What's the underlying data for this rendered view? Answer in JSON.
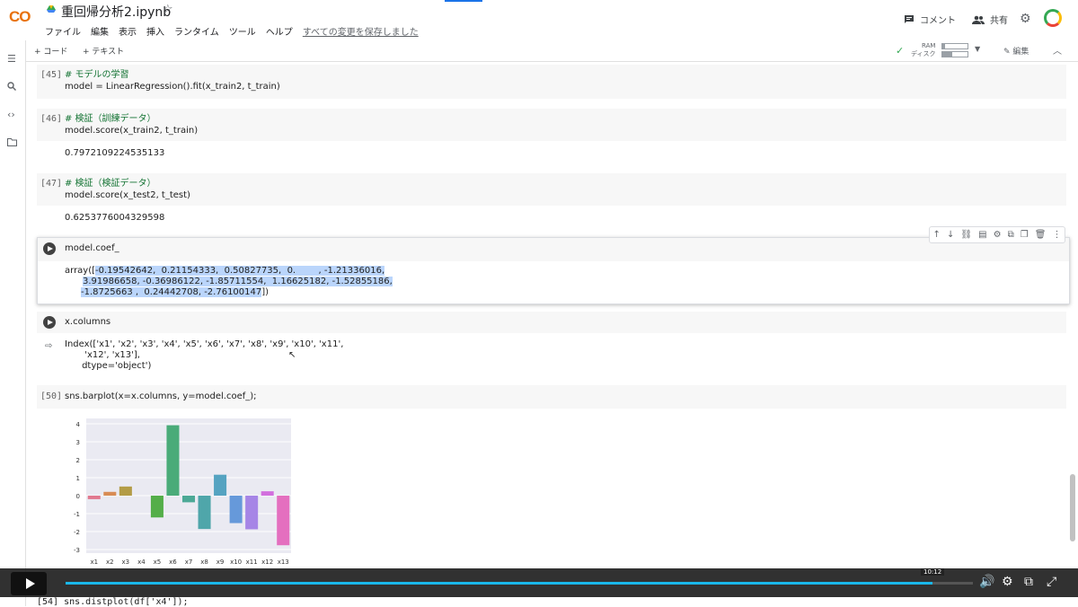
{
  "app": {
    "logo": "CO",
    "notebook_title": "重回帰分析2.ipynb",
    "star": "☆",
    "menu": [
      "ファイル",
      "編集",
      "表示",
      "挿入",
      "ランタイム",
      "ツール",
      "ヘルプ"
    ],
    "saved_message": "すべての変更を保存しました",
    "comment_label": "コメント",
    "share_label": "共有"
  },
  "toolbar": {
    "add_code": "+ コード",
    "add_text": "+ テキスト",
    "ram_label": "RAM",
    "disk_label": "ディスク",
    "ram_level": 0.1,
    "disk_level": 0.4,
    "edit_label": "編集"
  },
  "cells": {
    "c45": {
      "prompt": "[45]",
      "comment": "# モデルの学習",
      "code": "model = LinearRegression().fit(x_train2, t_train)"
    },
    "c46": {
      "prompt": "[46]",
      "comment": "# 検証（訓練データ）",
      "code": "model.score(x_train2, t_train)",
      "output": "0.7972109224535133"
    },
    "c47": {
      "prompt": "[47]",
      "comment": "# 検証（検証データ）",
      "code": "model.score(x_test2, t_test)",
      "output": "0.6253776004329598"
    },
    "coef": {
      "code": "model.coef_",
      "out_prefix": "array([",
      "out_line1": "-0.19542642,  0.21154333,  0.50827735,  0.        , -1.21336016,",
      "out_line2": "3.91986658, -0.36986122, -1.85711554,  1.16625182, -1.52855186,",
      "out_line3": "-1.8725663 ,  0.24442708, -2.76100147",
      "out_suffix": "])"
    },
    "columns": {
      "code": "x.columns",
      "output": "Index(['x1', 'x2', 'x3', 'x4', 'x5', 'x6', 'x7', 'x8', 'x9', 'x10', 'x11',\n       'x12', 'x13'],\n      dtype='object')"
    },
    "c50": {
      "prompt": "[50]",
      "code": "sns.barplot(x=x.columns, y=model.coef_);"
    },
    "c54": {
      "code": "[54] sns.distplot(df['x4']);"
    }
  },
  "video": {
    "progress": 0.955,
    "time_label": "10:12"
  },
  "chart_data": {
    "type": "bar",
    "categories": [
      "x1",
      "x2",
      "x3",
      "x4",
      "x5",
      "x6",
      "x7",
      "x8",
      "x9",
      "x10",
      "x11",
      "x12",
      "x13"
    ],
    "values": [
      -0.19542642,
      0.21154333,
      0.50827735,
      0.0,
      -1.21336016,
      3.91986658,
      -0.36986122,
      -1.85711554,
      1.16625182,
      -1.52855186,
      -1.8725663,
      0.24442708,
      -2.76100147
    ],
    "colors": [
      "#e1798f",
      "#d88c55",
      "#b39c46",
      "#95a548",
      "#54ae49",
      "#4aab79",
      "#4ca996",
      "#4fa6aa",
      "#55a3c1",
      "#6699da",
      "#a685e6",
      "#d270de",
      "#e46fbf"
    ],
    "yticks": [
      4,
      3,
      2,
      1,
      0,
      -1,
      -2,
      -3
    ],
    "ylim": [
      -3.2,
      4.3
    ],
    "grid": true,
    "background": "#eaeaf2"
  }
}
